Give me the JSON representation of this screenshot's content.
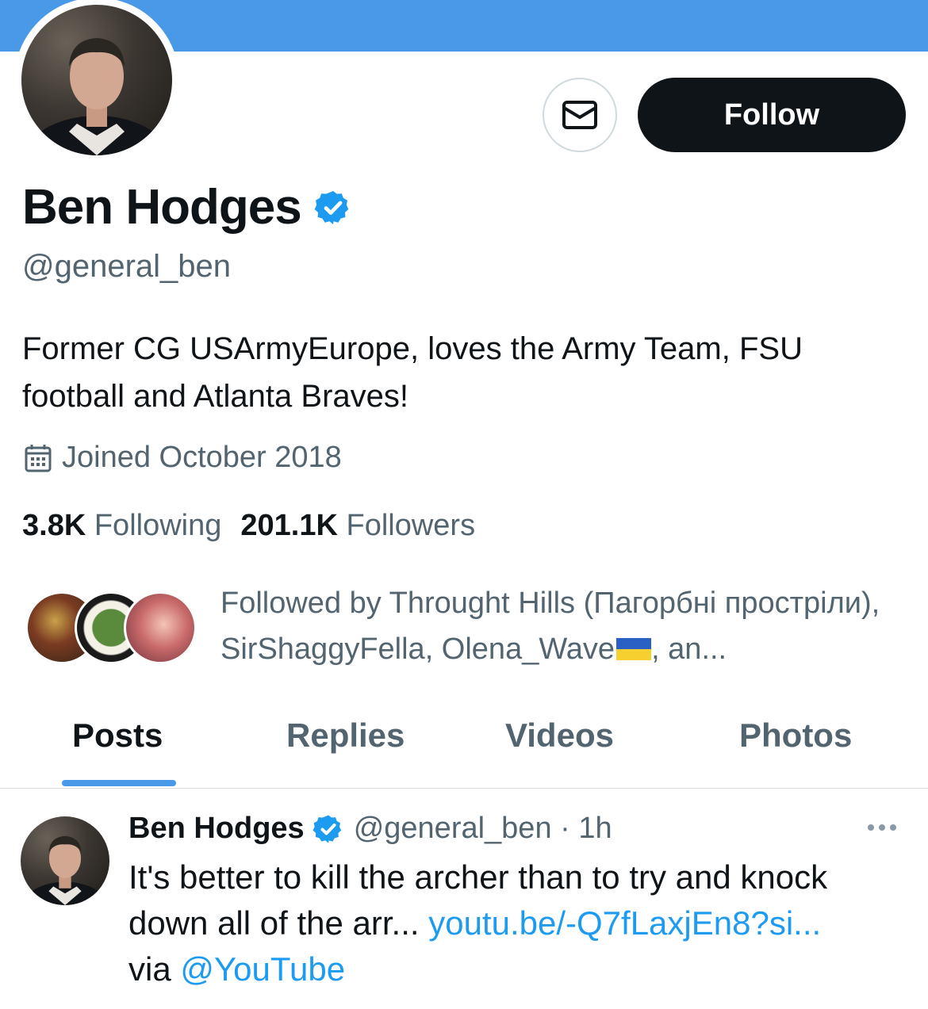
{
  "colors": {
    "banner": "#4a99e9",
    "verified": "#1d9bf0",
    "link": "#1d9bf0",
    "text_secondary": "#536471"
  },
  "profile": {
    "name": "Ben Hodges",
    "handle": "@general_ben",
    "bio": "Former CG USArmyEurope, loves the Army Team, FSU football and Atlanta Braves!",
    "joined": "Joined October 2018",
    "following_count": "3.8K",
    "following_label": "Following",
    "followers_count": "201.1K",
    "followers_label": "Followers",
    "followed_by": "Followed by Throught Hills (Пагорбні прострiли), SirShaggyFella, Olena_Wave",
    "followed_by_suffix": ", an..."
  },
  "actions": {
    "follow_label": "Follow",
    "message_icon": "envelope-icon"
  },
  "tabs": [
    {
      "label": "Posts",
      "active": true
    },
    {
      "label": "Replies",
      "active": false
    },
    {
      "label": "Videos",
      "active": false
    },
    {
      "label": "Photos",
      "active": false
    }
  ],
  "post": {
    "author": "Ben Hodges",
    "handle_time": "@general_ben · 1h",
    "text": "It's better to kill the archer than to try and knock down all of the arr...",
    "link": "youtu.be/-Q7fLaxjEn8?si...",
    "via": "via",
    "mention": "@YouTube"
  }
}
